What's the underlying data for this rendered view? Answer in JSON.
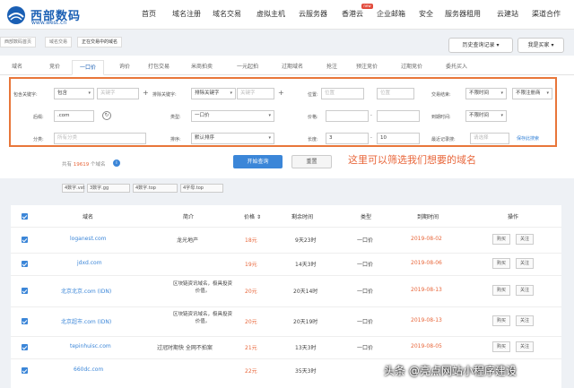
{
  "header": {
    "logo_cn": "西部数码",
    "logo_url": "www.west.cn",
    "nav": [
      "首页",
      "域名注册",
      "域名交易",
      "虚拟主机",
      "云服务器",
      "香港云",
      "企业邮箱",
      "安全",
      "服务器租用",
      "云建站",
      "渠道合作"
    ],
    "nav_badge": "new"
  },
  "breadcrumbs": [
    "西部数码首页",
    "域名交易",
    "正在交易中的域名"
  ],
  "history_button": "历史查询记录",
  "role_button": "我是买家",
  "tabs": [
    "域名",
    "竞价",
    "一口价",
    "询价",
    "打包交易",
    "米商拍卖",
    "一元起拍",
    "过期域名",
    "抢注",
    "预注竞价",
    "过期竞价",
    "委托买入"
  ],
  "active_tab": 2,
  "filters": {
    "contains_kw_label": "包含关键字:",
    "contains_kw_mode": "包含",
    "contains_kw_placeholder": "关键字",
    "exclude_kw_label": "排除关键字:",
    "exclude_kw_mode": "排除关键字",
    "exclude_kw_placeholder": "关键字",
    "length_label": "位置:",
    "length_placeholder": "位置",
    "length_placeholder2": "位置",
    "trade_label": "交易结束:",
    "trade_value": "不限时间",
    "reg_label": "不限注册商",
    "suffix_label": "后缀:",
    "suffix_value": ".com",
    "type_label": "类型:",
    "type_value": "一口价",
    "price_label": "价格:",
    "dash": "-",
    "expire_label": "到期时间:",
    "expire_value": "不限时间",
    "intro_label": "分类:",
    "intro_placeholder": "所有分类",
    "sort_label": "排序:",
    "sort_value": "默认排序",
    "len_label": "长度:",
    "len_min": "3",
    "len_max": "10",
    "save_label": "最近记录搜:",
    "save_placeholder": "请选择",
    "save_link": "保存此搜索"
  },
  "search_button": "开始查询",
  "reset_button": "重置",
  "annotation": "这里可以筛选我们想要的域名",
  "result_count_prefix": "共有",
  "result_count": "19619",
  "result_count_suffix": "个域名",
  "tags": [
    "4数字.vst",
    "3数字.gg",
    "4数字.top",
    "4字母.top"
  ],
  "table": {
    "headers": [
      "域名",
      "简介",
      "价格",
      "剩余时间",
      "类型",
      "到期时间",
      "操作"
    ],
    "rows": [
      {
        "domain": "loganest.com",
        "intro": "龙光地产",
        "price": "18元",
        "remaining": "9天23时",
        "type": "一口价",
        "expire": "2019-08-02",
        "buy": "购买",
        "follow": "关注"
      },
      {
        "domain": "jdxd.com",
        "intro": "",
        "price": "19元",
        "remaining": "14天3时",
        "type": "一口价",
        "expire": "2019-08-06",
        "buy": "购买",
        "follow": "关注"
      },
      {
        "domain": "北京北京.com (IDN)",
        "intro": "区块链资讯域名，极具投资价值。",
        "price": "20元",
        "remaining": "20天14时",
        "type": "一口价",
        "expire": "2019-08-13",
        "buy": "购买",
        "follow": "关注"
      },
      {
        "domain": "北京超市.com (IDN)",
        "intro": "区块链资讯域名，极具投资价值。",
        "price": "20元",
        "remaining": "20天19时",
        "type": "一口价",
        "expire": "2019-08-13",
        "buy": "购买",
        "follow": "关注"
      },
      {
        "domain": "tepinhuisc.com",
        "intro": "过冠时期快 全网不拍案",
        "price": "21元",
        "remaining": "13天3时",
        "type": "一口价",
        "expire": "2019-08-05",
        "buy": "购买",
        "follow": "关注"
      },
      {
        "domain": "660dc.com",
        "intro": "",
        "price": "22元",
        "remaining": "35天3时",
        "type": "",
        "expire": "",
        "buy": "",
        "follow": ""
      }
    ]
  },
  "watermark": "头条 @亮点网站小程序建设",
  "colors": {
    "accent": "#3b86d8",
    "highlight": "#e8663a",
    "annotation_border": "#e8763a"
  }
}
